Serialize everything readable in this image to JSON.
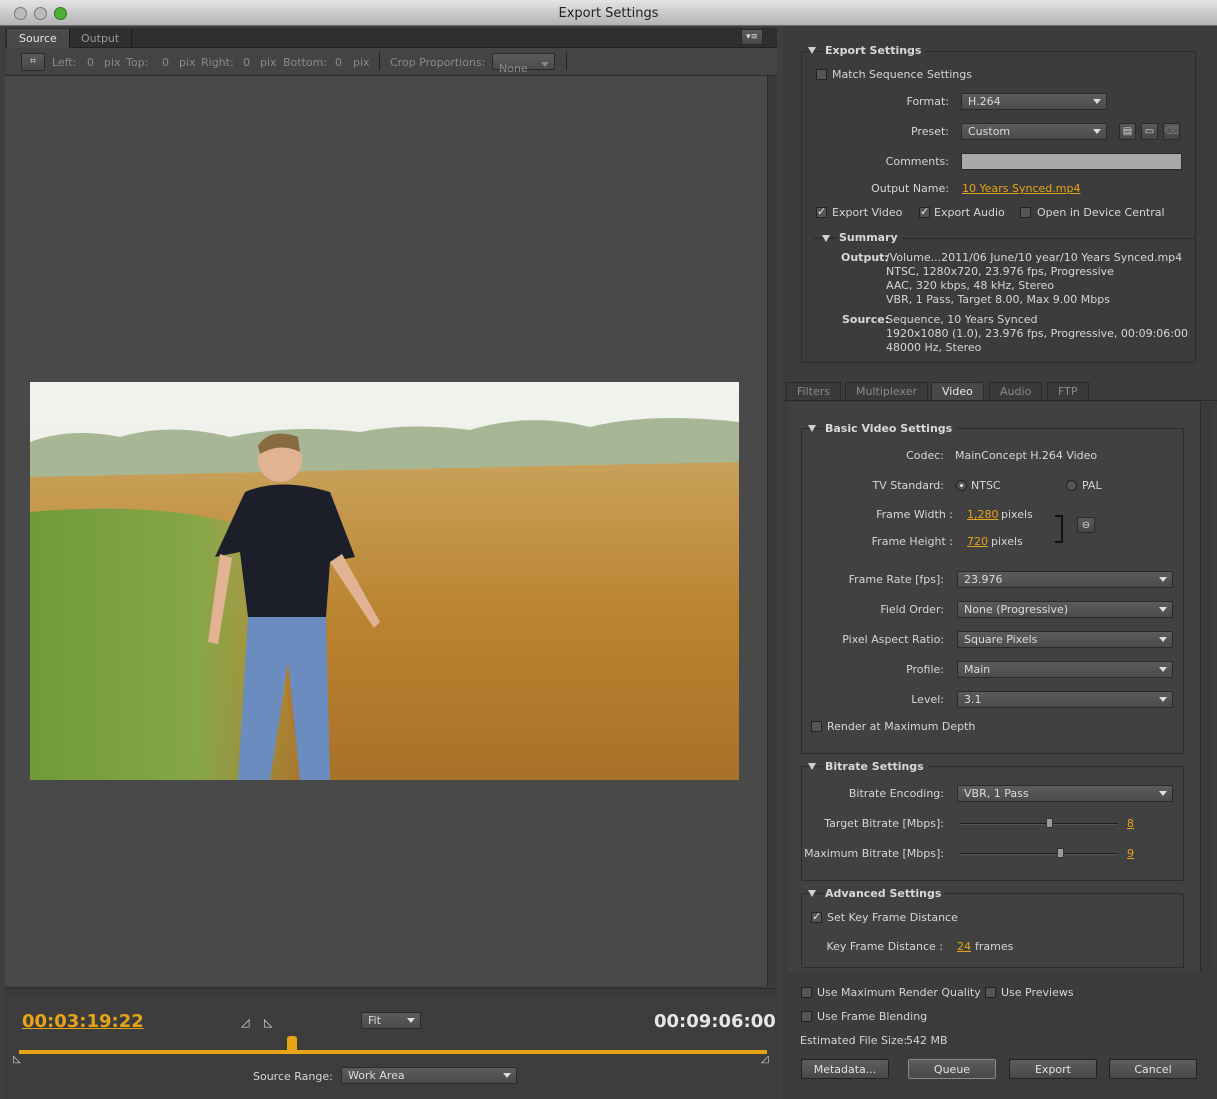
{
  "window": {
    "title": "Export Settings"
  },
  "left": {
    "tabs": [
      {
        "label": "Source"
      },
      {
        "label": "Output"
      }
    ],
    "crop": {
      "left_label": "Left:",
      "left_value": "0",
      "top_label": "Top:",
      "top_value": "0",
      "right_label": "Right:",
      "right_value": "0",
      "bottom_label": "Bottom:",
      "bottom_value": "0",
      "unit": "pix",
      "proportions_label": "Crop Proportions:",
      "proportions_value": "None"
    },
    "timeline": {
      "current_time": "00:03:19:22",
      "duration": "00:09:06:00",
      "zoom": "Fit",
      "playhead_fraction": 0.365,
      "source_range_label": "Source Range:",
      "source_range_value": "Work Area"
    }
  },
  "export_settings": {
    "header": "Export Settings",
    "match_sequence": "Match Sequence Settings",
    "format_label": "Format:",
    "format_value": "H.264",
    "preset_label": "Preset:",
    "preset_value": "Custom",
    "comments_label": "Comments:",
    "output_name_label": "Output Name:",
    "output_name_value": "10 Years Synced.mp4",
    "export_video": "Export Video",
    "export_audio": "Export Audio",
    "open_device_central": "Open in Device Central",
    "summary": {
      "header": "Summary",
      "output_label": "Output:",
      "output_lines": [
        "/Volume...2011/06 June/10 year/10 Years Synced.mp4",
        "NTSC, 1280x720, 23.976 fps, Progressive",
        "AAC, 320 kbps, 48 kHz, Stereo",
        "VBR, 1 Pass, Target 8.00, Max 9.00 Mbps"
      ],
      "source_label": "Source:",
      "source_lines": [
        "Sequence, 10 Years Synced",
        "1920x1080 (1.0), 23.976 fps, Progressive, 00:09:06:00",
        "48000 Hz, Stereo"
      ]
    }
  },
  "right_tabs": [
    {
      "label": "Filters"
    },
    {
      "label": "Multiplexer"
    },
    {
      "label": "Video"
    },
    {
      "label": "Audio"
    },
    {
      "label": "FTP"
    }
  ],
  "video": {
    "basic_header": "Basic Video Settings",
    "codec_label": "Codec:",
    "codec_value": "MainConcept H.264 Video",
    "tv_label": "TV Standard:",
    "ntsc": "NTSC",
    "pal": "PAL",
    "width_label": "Frame Width :",
    "width_value": "1,280",
    "height_label": "Frame Height :",
    "height_value": "720",
    "pixels": "pixels",
    "frame_rate_label": "Frame Rate [fps]:",
    "frame_rate_value": "23.976",
    "field_order_label": "Field Order:",
    "field_order_value": "None (Progressive)",
    "par_label": "Pixel Aspect Ratio:",
    "par_value": "Square Pixels",
    "profile_label": "Profile:",
    "profile_value": "Main",
    "level_label": "Level:",
    "level_value": "3.1",
    "render_max_depth": "Render at Maximum Depth",
    "bitrate_header": "Bitrate Settings",
    "encoding_label": "Bitrate Encoding:",
    "encoding_value": "VBR, 1 Pass",
    "target_label": "Target Bitrate [Mbps]:",
    "target_value": "8",
    "max_label": "Maximum Bitrate [Mbps]:",
    "max_value": "9",
    "advanced_header": "Advanced Settings",
    "set_keyframe": "Set Key Frame Distance",
    "keyframe_label": "Key Frame Distance :",
    "keyframe_value": "24",
    "frames": "frames"
  },
  "footer": {
    "max_render_quality": "Use Maximum Render Quality",
    "use_previews": "Use Previews",
    "frame_blending": "Use Frame Blending",
    "file_size_label": "Estimated File Size:",
    "file_size_value": "542 MB",
    "metadata": "Metadata...",
    "queue": "Queue",
    "export": "Export",
    "cancel": "Cancel"
  },
  "colors": {
    "accent": "#e8a317"
  }
}
